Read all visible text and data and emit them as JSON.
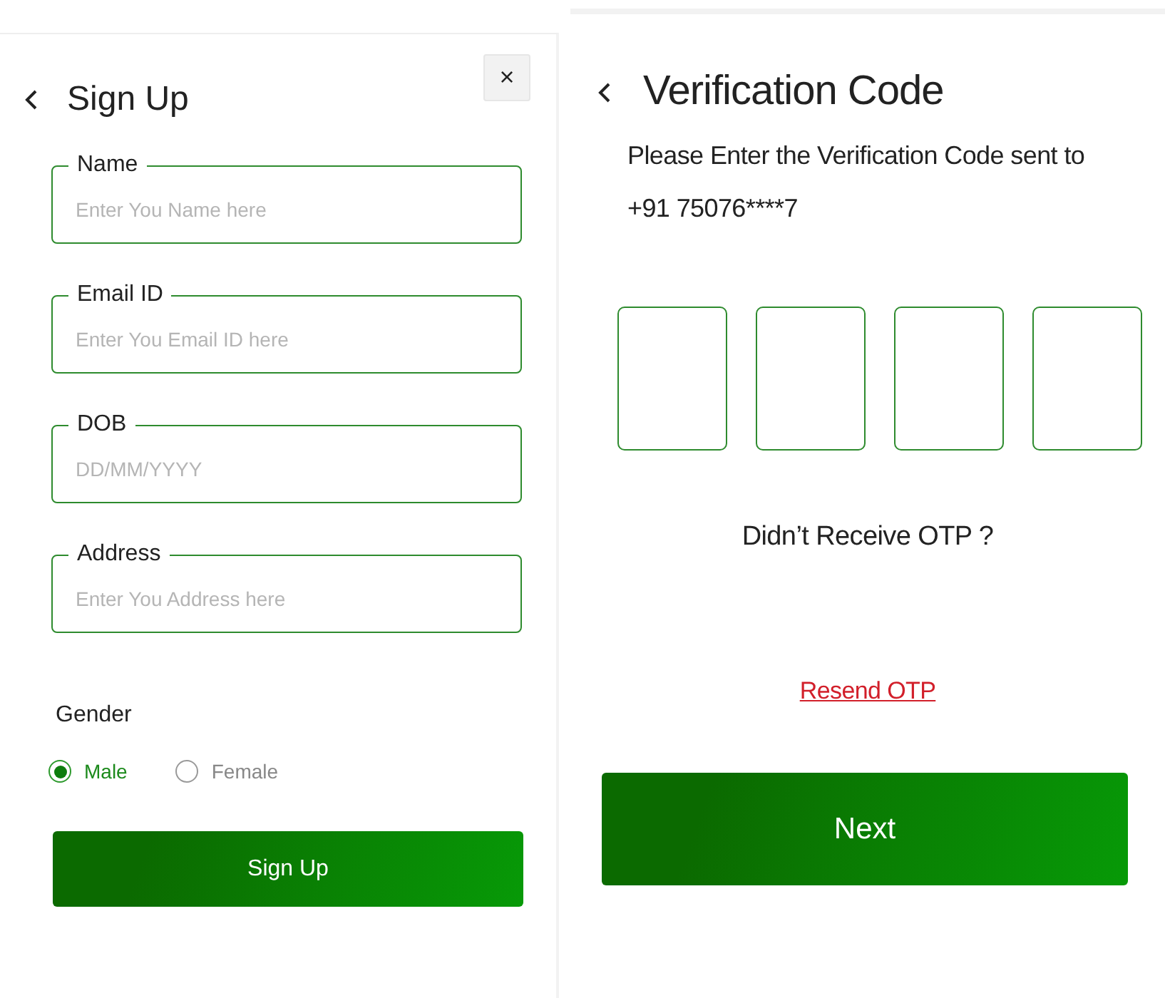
{
  "sign_up": {
    "title": "Sign Up",
    "close_label": "×",
    "fields": [
      {
        "label": "Name",
        "placeholder": "Enter You Name here"
      },
      {
        "label": "Email ID",
        "placeholder": "Enter You Email ID here"
      },
      {
        "label": "DOB",
        "placeholder": "DD/MM/YYYY"
      },
      {
        "label": "Address",
        "placeholder": "Enter You Address here"
      }
    ],
    "gender": {
      "label": "Gender",
      "options": [
        {
          "label": "Male",
          "selected": true
        },
        {
          "label": "Female",
          "selected": false
        }
      ]
    },
    "submit": "Sign Up"
  },
  "verification": {
    "title": "Verification Code",
    "message": "Please Enter the Verification Code sent to",
    "phone": "+91 75076****7",
    "otp_boxes": [
      {
        "kind": "digit"
      },
      {
        "kind": "digit"
      },
      {
        "kind": "digit"
      },
      {
        "kind": "digit"
      }
    ],
    "no_otp": "Didn’t Receive OTP ?",
    "resend": "Resend OTP",
    "next": "Next"
  }
}
